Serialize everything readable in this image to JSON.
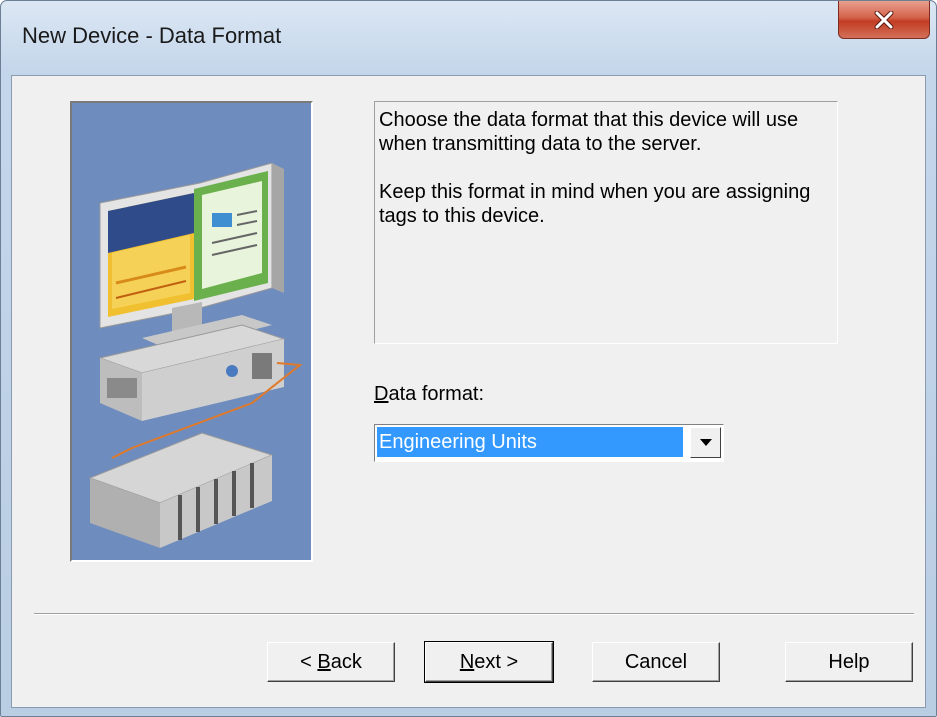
{
  "window": {
    "title": "New Device - Data Format"
  },
  "description": {
    "paragraph1": "Choose the data format that this device will use when transmitting data to the server.",
    "paragraph2": "Keep this format in mind when you are assigning tags to this device."
  },
  "data_format": {
    "label_accel": "D",
    "label_rest": "ata format:",
    "selected": "Engineering Units"
  },
  "buttons": {
    "back_prefix": "< ",
    "back_accel": "B",
    "back_rest": "ack",
    "next_accel": "N",
    "next_rest": "ext >",
    "cancel": "Cancel",
    "help": "Help"
  },
  "icons": {
    "close": "close-icon",
    "dropdown": "chevron-down-icon",
    "illustration": "computer-device-illustration"
  },
  "colors": {
    "selection": "#3399ff",
    "close_button": "#c23c22",
    "illustration_bg": "#6e8cbd"
  }
}
